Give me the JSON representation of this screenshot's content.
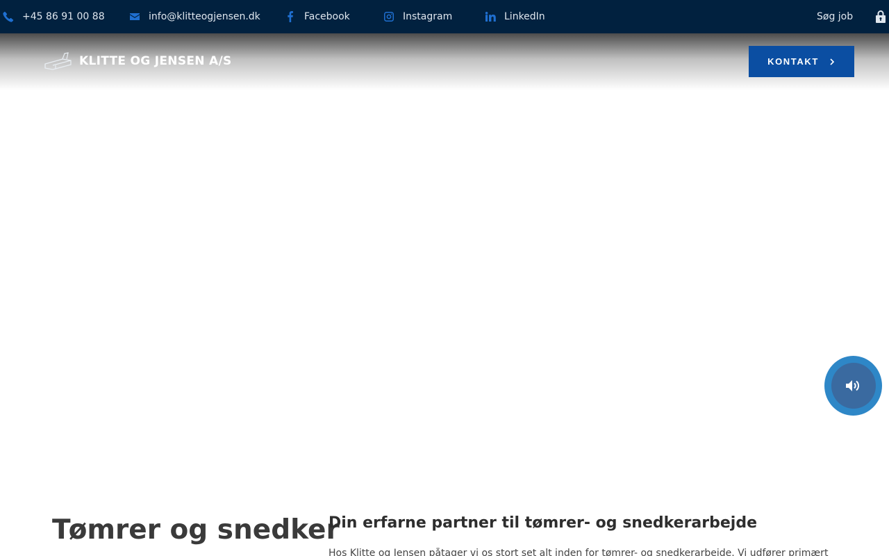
{
  "topbar": {
    "phone": "+45 86 91 00 88",
    "email": "info@klitteogjensen.dk",
    "facebook": "Facebook",
    "instagram": "Instagram",
    "linkedin": "LinkedIn",
    "jobs": "Søg job",
    "icons": {
      "phone": "phone-icon",
      "email": "envelope-icon",
      "facebook": "facebook-icon",
      "instagram": "instagram-icon",
      "linkedin": "linkedin-icon",
      "lock": "lock-icon"
    }
  },
  "header": {
    "logo_text": "KLITTE OG JENSEN A/S",
    "contact_button": "KONTAKT"
  },
  "content": {
    "heading": "Tømrer og snedker",
    "subheading": "Din erfarne partner til tømrer- og snedkerarbejde",
    "intro": "Hos Klitte og Jensen påtager vi os stort set alt inden for tømrer- og snedkerarbejde. Vi udfører primært"
  },
  "colors": {
    "topbar_bg": "#01213f",
    "accent": "#1f6fd0",
    "button_bg": "#0b4ea2",
    "audio_outer": "#2e87c7",
    "audio_inner": "#3a6aa0"
  }
}
